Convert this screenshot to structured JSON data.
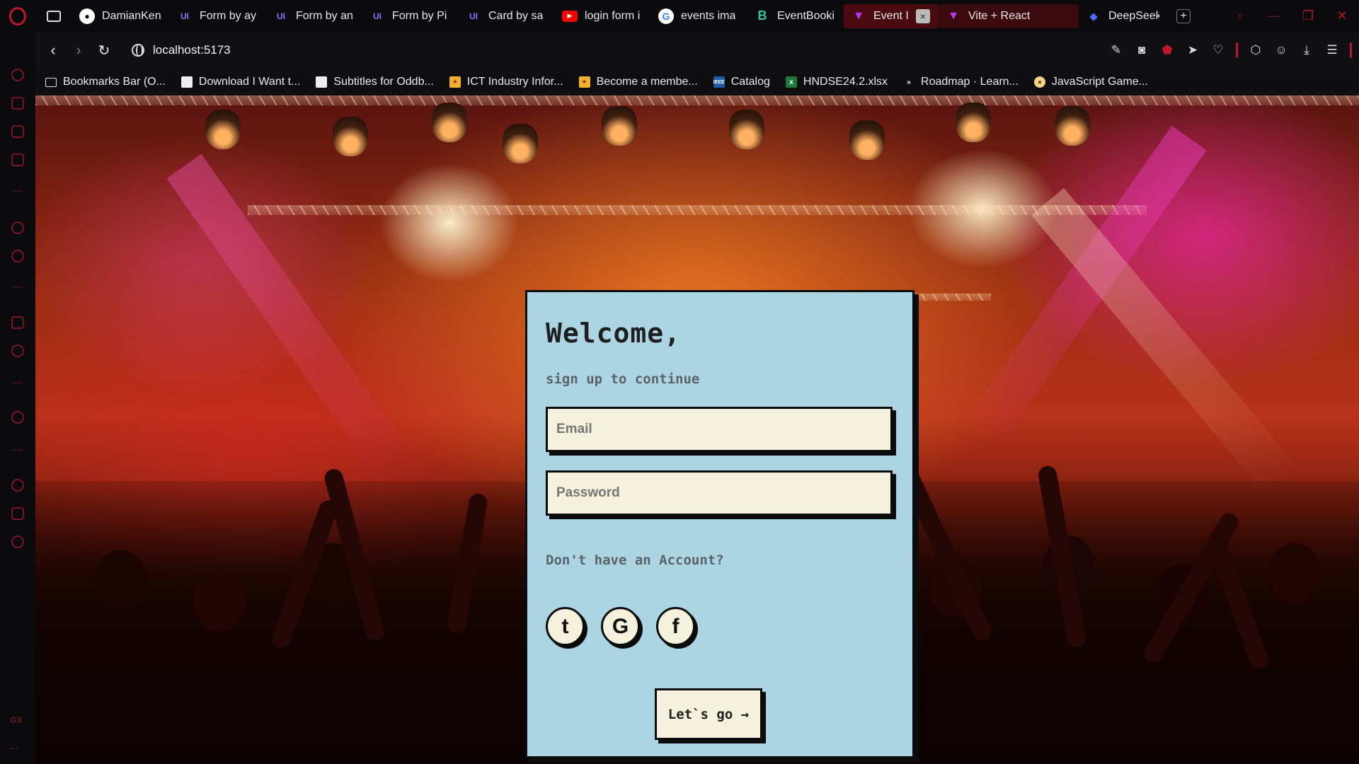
{
  "tabs": [
    {
      "label": "DamianKen",
      "icon": "github-icon",
      "color": "#ffffff"
    },
    {
      "label": "Form by ay",
      "icon": "uiverse-icon",
      "color": "#6c63ff"
    },
    {
      "label": "Form by an",
      "icon": "uiverse-icon",
      "color": "#6c63ff"
    },
    {
      "label": "Form by Pi",
      "icon": "uiverse-icon",
      "color": "#6c63ff"
    },
    {
      "label": "Card by sa",
      "icon": "uiverse-icon",
      "color": "#6c63ff"
    },
    {
      "label": "login form i",
      "icon": "youtube-icon",
      "color": "#ff0000"
    },
    {
      "label": "events ima",
      "icon": "google-icon",
      "color": "#ffffff"
    },
    {
      "label": "EventBooki",
      "icon": "eventbooking-icon",
      "color": "#36c5a0"
    },
    {
      "label": "Event I",
      "icon": "vite-icon",
      "color": "#bd34fe",
      "active": true
    },
    {
      "label": "Vite + React",
      "icon": "vite-icon",
      "color": "#bd34fe",
      "active": true
    },
    {
      "label": "DeepSeek",
      "icon": "deepseek-icon",
      "color": "#4d6bfe"
    }
  ],
  "address": {
    "url": "localhost:5173"
  },
  "bookmarks": [
    {
      "label": "Bookmarks Bar (O...",
      "icon": "folder-icon"
    },
    {
      "label": "Download I Want t...",
      "icon": "file-icon"
    },
    {
      "label": "Subtitles for Oddb...",
      "icon": "file-icon"
    },
    {
      "label": "ICT Industry Infor...",
      "icon": "flag-icon"
    },
    {
      "label": "Become a membe...",
      "icon": "flag-icon"
    },
    {
      "label": "Catalog",
      "icon": "ieee-icon"
    },
    {
      "label": "HNDSE24.2.xlsx",
      "icon": "excel-icon"
    },
    {
      "label": "Roadmap · Learn...",
      "icon": "roadmap-icon"
    },
    {
      "label": "JavaScript Game...",
      "icon": "game-icon"
    }
  ],
  "form": {
    "title": "Welcome,",
    "subtitle": "sign up to continue",
    "email_placeholder": "Email",
    "password_placeholder": "Password",
    "no_account": "Don't have an Account?",
    "social": [
      {
        "glyph": "t",
        "icon": "twitter-icon"
      },
      {
        "glyph": "G",
        "icon": "google-icon"
      },
      {
        "glyph": "f",
        "icon": "facebook-icon"
      }
    ],
    "submit_label": "Let`s go →"
  },
  "colors": {
    "accent": "#c0162b",
    "card_bg": "#acd5e4",
    "input_bg": "#f4f1dc",
    "border": "#0c0c0c"
  }
}
